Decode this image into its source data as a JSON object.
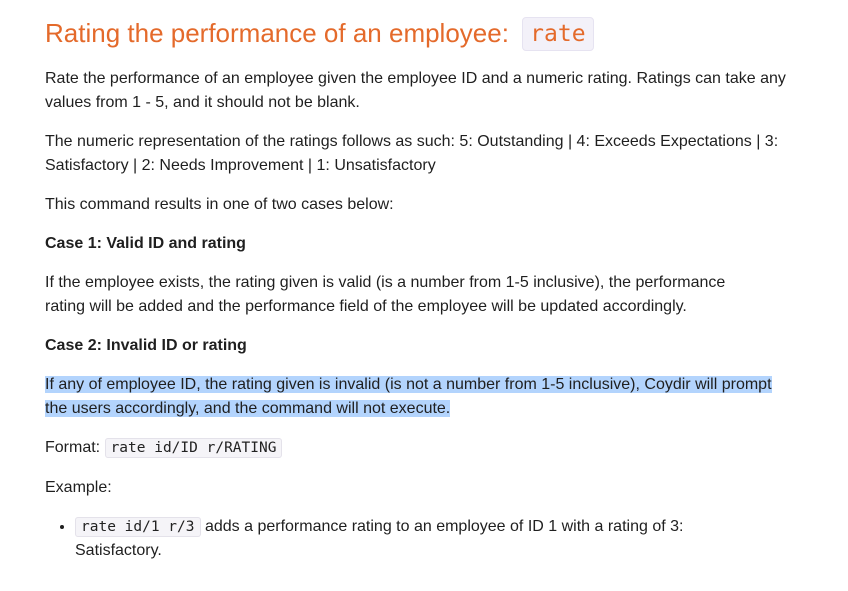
{
  "title": {
    "text": "Rating the performance of an employee:",
    "command": "rate"
  },
  "intro": "Rate the performance of an employee given the employee ID and a numeric rating. Ratings can take any values from 1 - 5, and it should not be blank.",
  "representation": "The numeric representation of the ratings follows as such: 5: Outstanding | 4: Exceeds Expectations | 3: Satisfactory | 2: Needs Improvement | 1: Unsatisfactory",
  "cases_intro": "This command results in one of two cases below:",
  "case1": {
    "heading": "Case 1: Valid ID and rating",
    "body": "If the employee exists, the rating given is valid (is a number from 1-5 inclusive), the performance rating will be added and the performance field of the employee will be updated accordingly."
  },
  "case2": {
    "heading": "Case 2: Invalid ID or rating",
    "body": "If any of employee ID, the rating given is invalid (is not a number from 1-5 inclusive), Coydir will prompt the users accordingly, and the command will not execute."
  },
  "format": {
    "label": "Format:",
    "code": "rate id/ID r/RATING"
  },
  "example": {
    "label": "Example:",
    "items": [
      {
        "code": "rate id/1 r/3",
        "text": "adds a performance rating to an employee of ID 1 with a rating of 3: Satisfactory."
      }
    ]
  },
  "colors": {
    "heading": "#e46a2b",
    "selection": "#b3d4fd",
    "code_bg": "#f5f4f8"
  }
}
